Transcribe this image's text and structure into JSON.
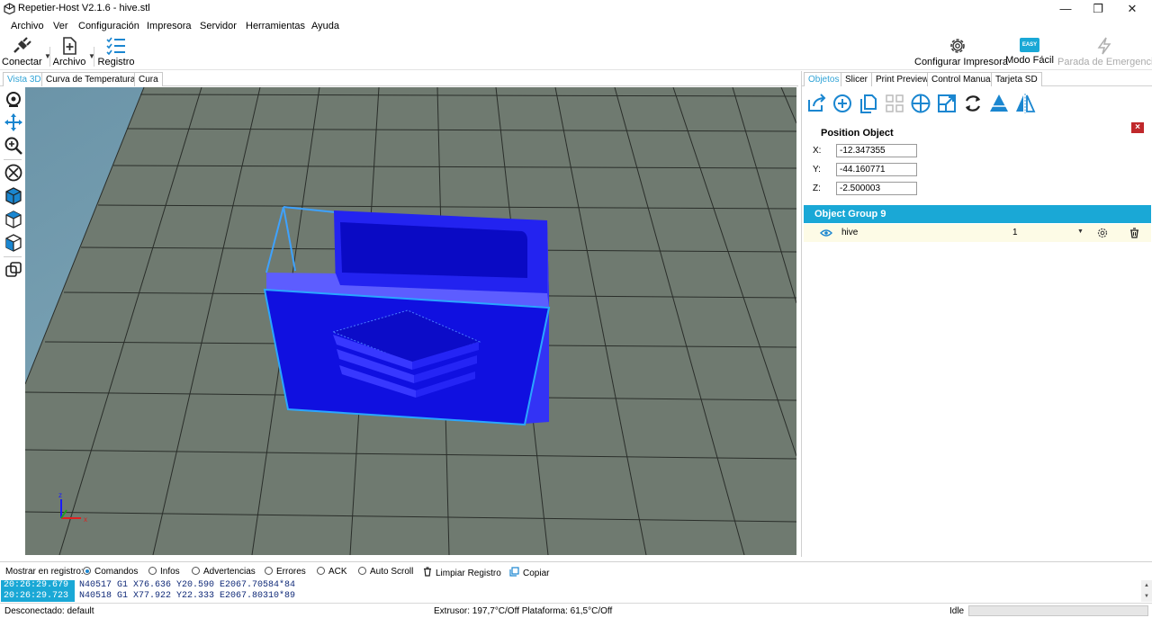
{
  "window": {
    "title": "Repetier-Host V2.1.6 - hive.stl"
  },
  "menu": [
    "Archivo",
    "Ver",
    "Configuración",
    "Impresora",
    "Servidor",
    "Herramientas",
    "Ayuda"
  ],
  "toolbar": {
    "connect": "Conectar",
    "file": "Archivo",
    "log": "Registro",
    "configure_printer": "Configurar Impresora",
    "easy_mode": "Modo Fácil",
    "easy_badge": "EASY",
    "emergency_stop": "Parada de Emergencia"
  },
  "left_tabs": [
    "Vista 3D",
    "Curva de Temperatura",
    "Cura"
  ],
  "right_tabs": [
    "Objetos",
    "Slicer",
    "Print Preview",
    "Control Manual",
    "Tarjeta SD"
  ],
  "position_object": {
    "title": "Position Object",
    "close": "×",
    "x_label": "X:",
    "x_value": "-12.347355",
    "y_label": "Y:",
    "y_value": "-44.160771",
    "z_label": "Z:",
    "z_value": "-2.500003"
  },
  "object_group": {
    "title": "Object Group 9",
    "objects": [
      {
        "name": "hive",
        "quantity": "1"
      }
    ]
  },
  "log_filter": {
    "label": "Mostrar en registro:",
    "options": [
      "Comandos",
      "Infos",
      "Advertencias",
      "Errores",
      "ACK",
      "Auto Scroll"
    ],
    "selected": "Comandos",
    "clear": "Limpiar Registro",
    "copy": "Copiar"
  },
  "log_lines": [
    {
      "time": "20:26:29.679",
      "message": "N40517 G1 X76.636 Y20.590 E2067.70584*84"
    },
    {
      "time": "20:26:29.723",
      "message": "N40518 G1 X77.922 Y22.333 E2067.80310*89"
    }
  ],
  "status": {
    "connection": "Desconectado: default",
    "temperatures": "Extrusor: 197,7°C/Off Plataforma: 61,5°C/Off",
    "state": "Idle"
  },
  "colors": {
    "accent": "#1aa8d6",
    "model_blue": "#1414e0",
    "bed_gray": "#6f7a70",
    "close_red": "#c0282b"
  }
}
